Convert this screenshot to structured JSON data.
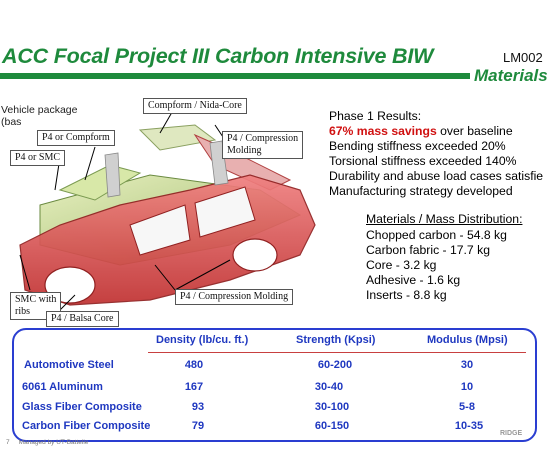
{
  "header": {
    "title": "ACC Focal Project III Carbon Intensive BIW",
    "code": "LM002",
    "subtitle": "Materials"
  },
  "vehicle": {
    "label_line1": "Vehicle package",
    "label_line2": "(bas"
  },
  "callouts": {
    "compform_nida": "Compform / Nida-Core",
    "p4_compform": "P4 or Compform",
    "p4_smc": "P4 or SMC",
    "p4_compression_1": "P4 / Compression",
    "p4_compression_2": "Molding",
    "smc_ribs_1": "SMC with",
    "smc_ribs_2": "ribs",
    "p4_compression_molding": "P4 / Compression Molding",
    "p4_balsa": "P4 / Balsa Core"
  },
  "results": {
    "heading": "Phase 1 Results:",
    "mass_savings_highlight": "67% mass savings",
    "mass_savings_rest": " over baseline",
    "items": [
      "Bending stiffness exceeded 20%",
      "Torsional stiffness exceeded 140%",
      "Durability and abuse load cases satisfie",
      "Manufacturing strategy developed"
    ]
  },
  "mass_distribution": {
    "heading": "Materials / Mass Distribution:",
    "items": [
      "Chopped carbon - 54.8 kg",
      "Carbon fabric - 17.7 kg",
      "Core - 3.2 kg",
      "Adhesive - 1.6 kg",
      "Inserts - 8.8 kg"
    ]
  },
  "table": {
    "headers": [
      "Density (lb/cu. ft.)",
      "Strength (Kpsi)",
      "Modulus (Mpsi)"
    ],
    "rows": [
      {
        "material": "Automotive Steel",
        "density": "480",
        "strength": "60-200",
        "modulus": "30"
      },
      {
        "material": "6061 Aluminum",
        "density": "167",
        "strength": "30-40",
        "modulus": "10"
      },
      {
        "material": "Glass Fiber Composite",
        "density": "93",
        "strength": "30-100",
        "modulus": "5-8"
      },
      {
        "material": "Carbon Fiber  Composite",
        "density": "79",
        "strength": "60-150",
        "modulus": "10-35"
      }
    ]
  },
  "footer": {
    "page": "7",
    "managed_by": "Managed by UT-Battelle",
    "logo_text": "RIDGE"
  }
}
